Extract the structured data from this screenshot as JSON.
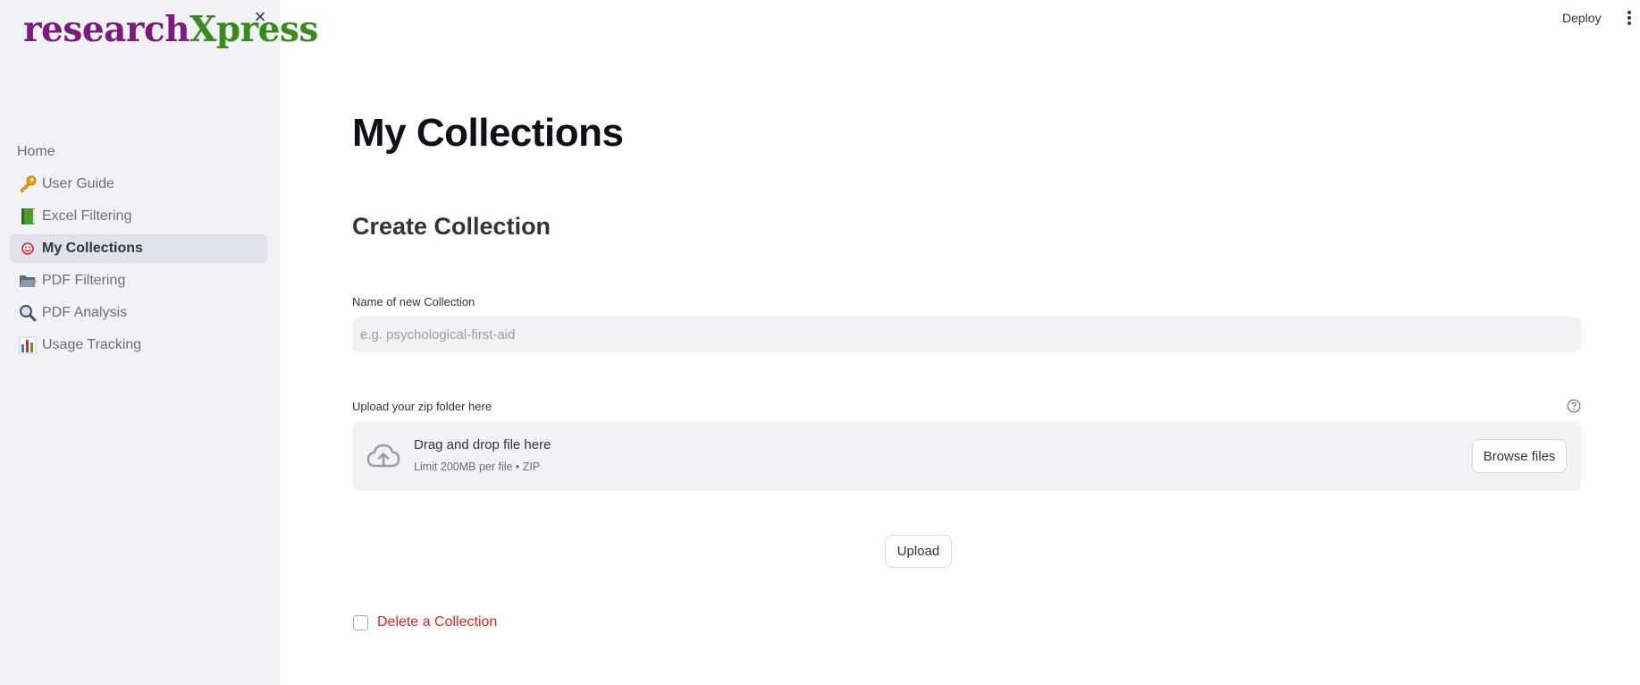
{
  "sidebar": {
    "logo_part1": "research",
    "logo_part2": "Xpress",
    "close_glyph": "×",
    "items": [
      {
        "label": "Home",
        "icon": "none"
      },
      {
        "label": "User Guide",
        "icon": "key-icon"
      },
      {
        "label": "Excel Filtering",
        "icon": "green-book-icon"
      },
      {
        "label": "My Collections",
        "icon": "smiley-icon"
      },
      {
        "label": "PDF Filtering",
        "icon": "open-folder-icon"
      },
      {
        "label": "PDF Analysis",
        "icon": "magnifier-icon"
      },
      {
        "label": "Usage Tracking",
        "icon": "bar-chart-icon"
      }
    ],
    "active_item": "My Collections"
  },
  "header": {
    "deploy_label": "Deploy"
  },
  "main": {
    "title": "My Collections",
    "section_title": "Create Collection",
    "name_field": {
      "label": "Name of new Collection",
      "placeholder": "e.g. psychological-first-aid",
      "value": ""
    },
    "upload_field": {
      "label": "Upload your zip folder here",
      "drop_title": "Drag and drop file here",
      "drop_sub": "Limit 200MB per file • ZIP",
      "browse_label": "Browse files"
    },
    "upload_button": "Upload",
    "delete_checkbox": {
      "label": "Delete a Collection",
      "checked": false
    }
  },
  "colors": {
    "logo_purple": "#7b1b7e",
    "logo_green": "#3a8a1e",
    "sidebar_bg": "#f0f2f6",
    "delete_red": "#e0261b"
  }
}
